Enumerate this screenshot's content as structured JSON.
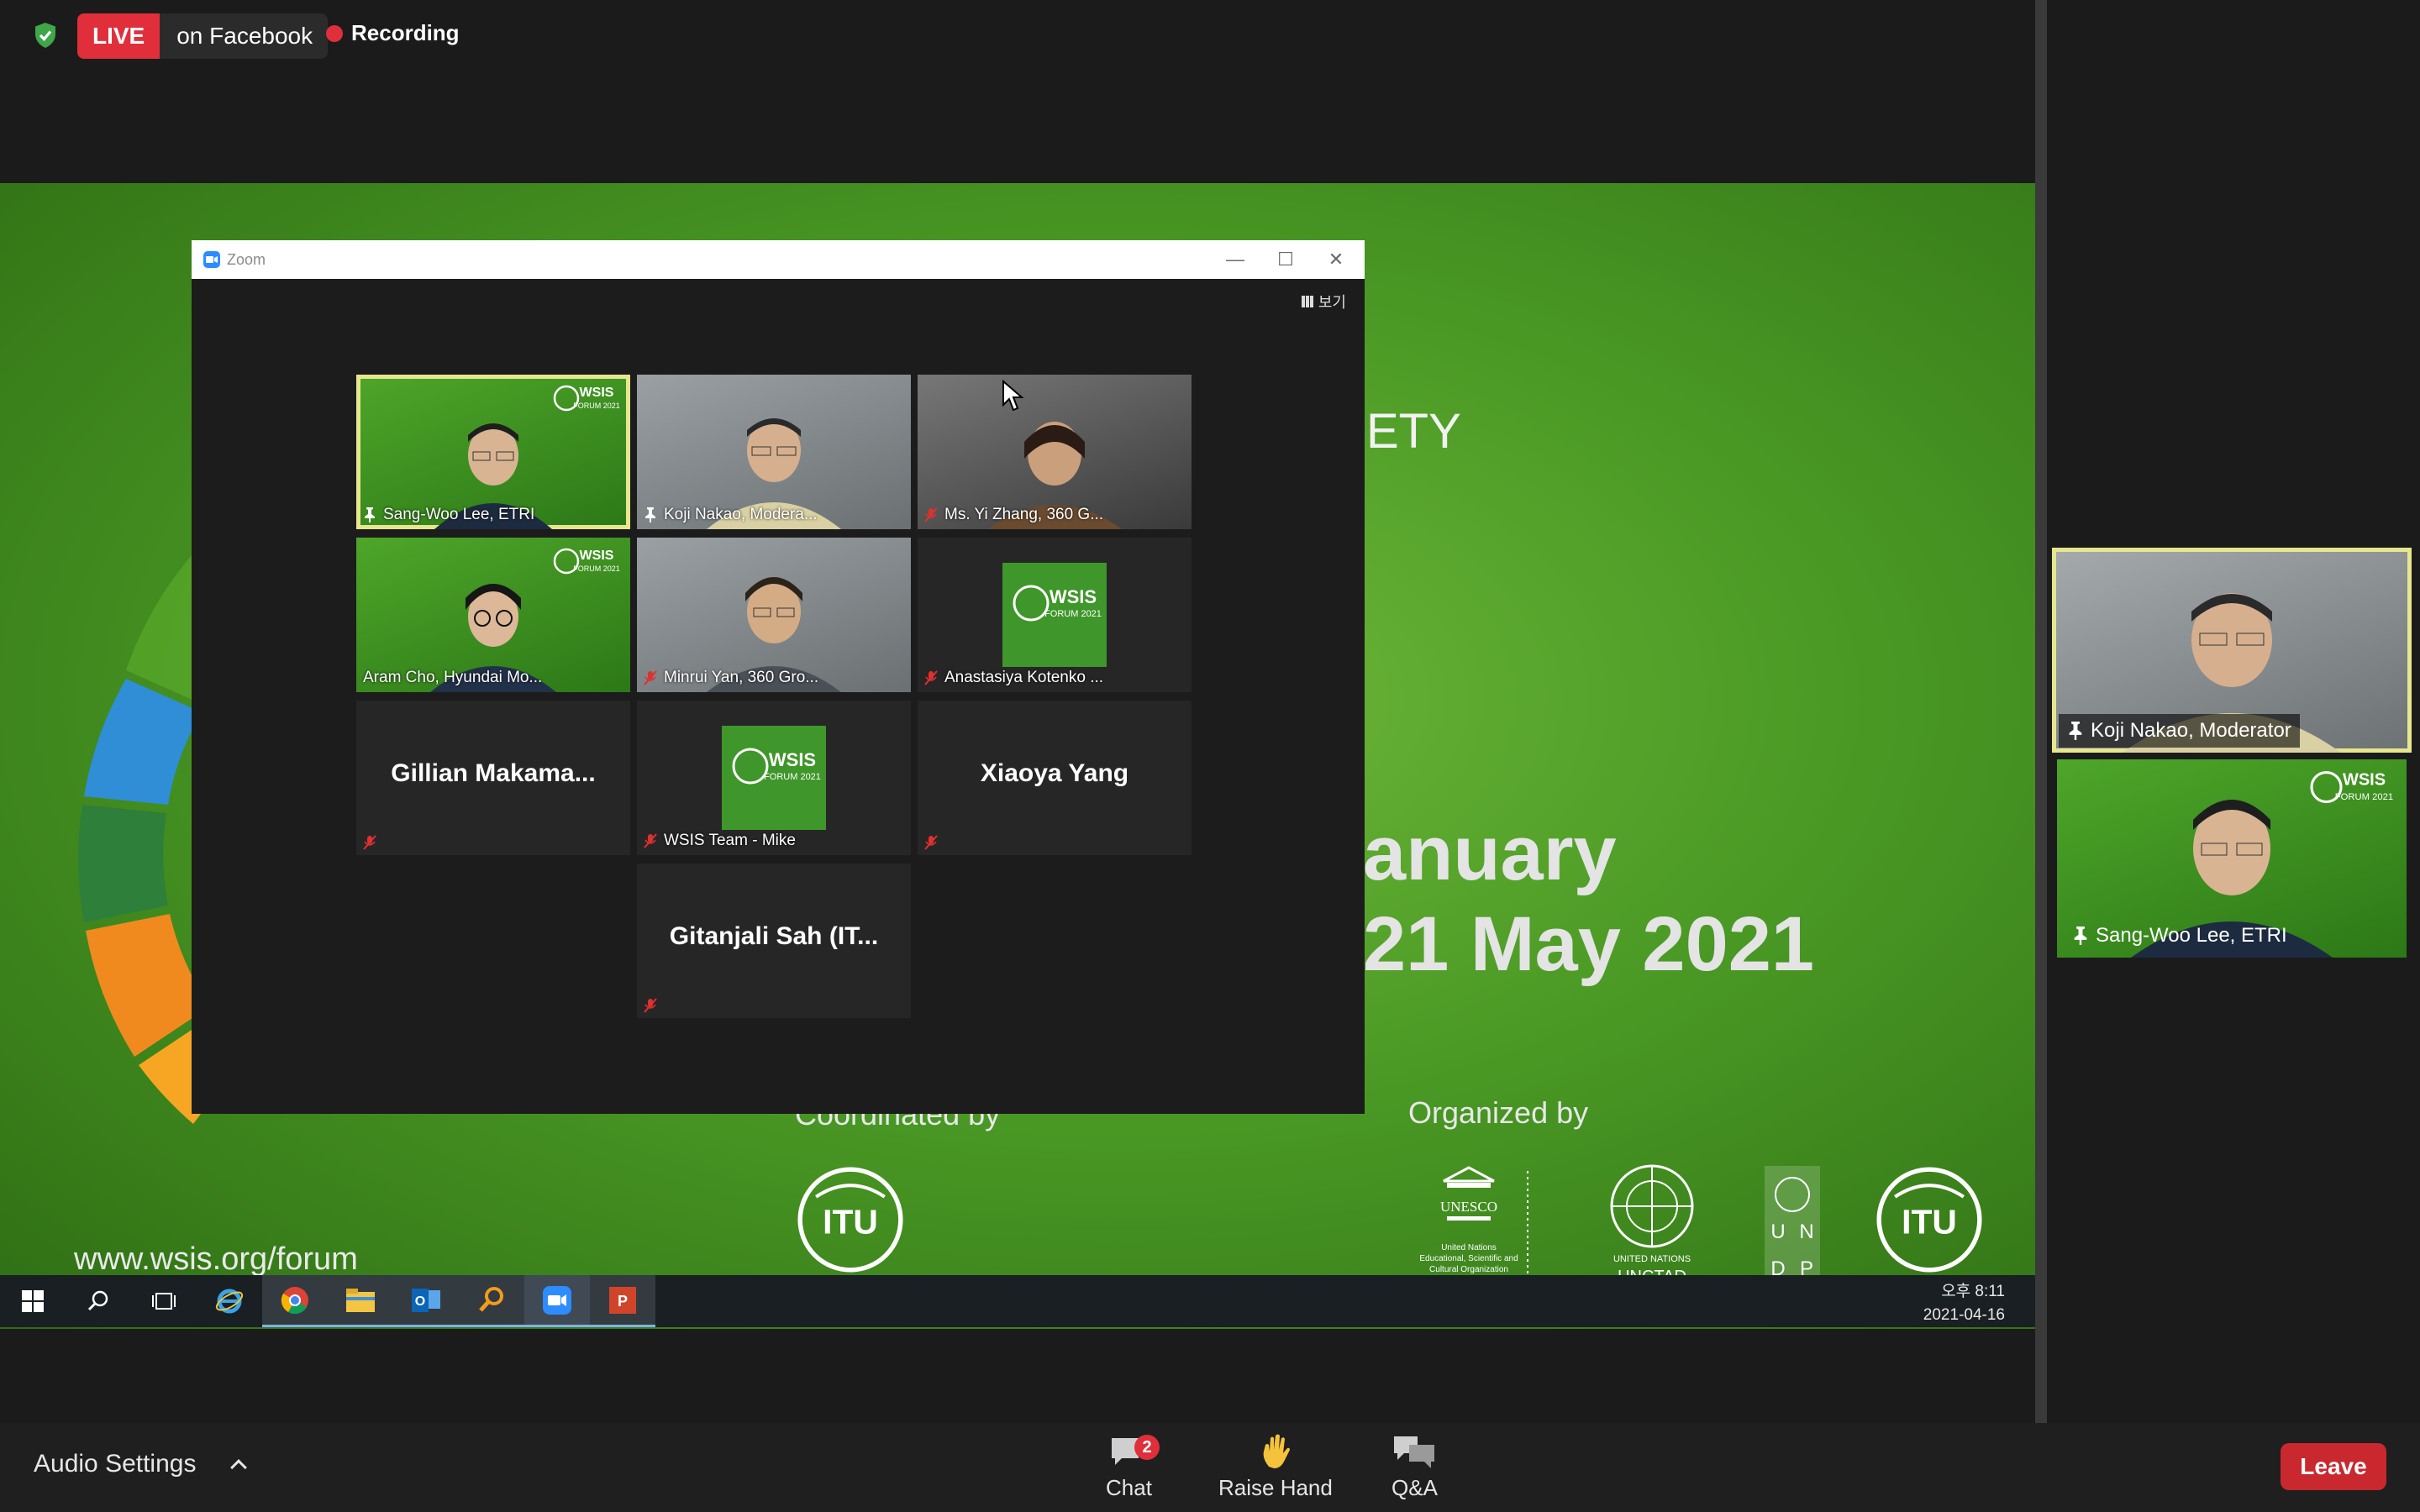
{
  "top": {
    "live_tag": "LIVE",
    "live_where": "on Facebook",
    "recording": "Recording"
  },
  "slide": {
    "ety": "ETY",
    "january": "anuary",
    "may": "21 May 2021",
    "coordinated_by": "Coordinated by",
    "organized_by": "Organized by",
    "url": "www.wsis.org/forum",
    "itu": "ITU",
    "unesco": "UNESCO",
    "unesco_sub1": "United Nations",
    "unesco_sub2": "Educational, Scientific and",
    "unesco_sub3": "Cultural Organization",
    "united_nations": "UNITED NATIONS",
    "unctad": "UNCTAD",
    "undp": [
      "U",
      "N",
      "D",
      "P"
    ]
  },
  "taskbar": {
    "time": "오후 8:11",
    "date": "2021-04-16"
  },
  "zoom_window": {
    "title": "Zoom",
    "view": "보기",
    "tiles": [
      {
        "name": "Sang-Woo Lee, ETRI"
      },
      {
        "name": "Koji Nakao, Modera..."
      },
      {
        "name": "Ms. Yi Zhang, 360 G..."
      },
      {
        "name": "Aram Cho, Hyundai Mo..."
      },
      {
        "name": "Minrui Yan, 360 Gro..."
      },
      {
        "name": "Anastasiya Kotenko ..."
      },
      {
        "name": "Gillian  Makama..."
      },
      {
        "name": "WSIS Team - Mike"
      },
      {
        "name": "Xiaoya Yang"
      },
      {
        "name": "Gitanjali Sah (IT..."
      }
    ],
    "wsis_line1": "WSIS",
    "wsis_line2": "FORUM 2021"
  },
  "speakers": [
    {
      "name": "Koji Nakao, Moderator"
    },
    {
      "name": "Sang-Woo Lee, ETRI"
    }
  ],
  "toolbar": {
    "audio_settings": "Audio Settings",
    "chat": "Chat",
    "chat_badge": "2",
    "raise_hand": "Raise Hand",
    "qa": "Q&A",
    "leave": "Leave"
  },
  "colors": {
    "live_red": "#e02f3a",
    "active_speaker": "#e6e68f",
    "wsis_green": "#4ea629",
    "leave_red": "#c9282f"
  }
}
